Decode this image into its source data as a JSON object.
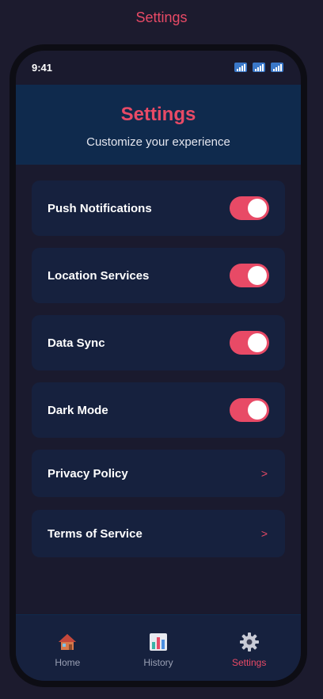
{
  "page": {
    "title": "Settings"
  },
  "status_bar": {
    "time": "9:41"
  },
  "header": {
    "title": "Settings",
    "subtitle": "Customize your experience"
  },
  "settings": {
    "toggles": [
      {
        "label": "Push Notifications",
        "enabled": true
      },
      {
        "label": "Location Services",
        "enabled": true
      },
      {
        "label": "Data Sync",
        "enabled": true
      },
      {
        "label": "Dark Mode",
        "enabled": true
      }
    ],
    "links": [
      {
        "label": "Privacy Policy",
        "chevron": ">"
      },
      {
        "label": "Terms of Service",
        "chevron": ">"
      }
    ]
  },
  "nav": {
    "items": [
      {
        "label": "Home",
        "icon": "home-icon"
      },
      {
        "label": "History",
        "icon": "history-icon"
      },
      {
        "label": "Settings",
        "icon": "gear-icon",
        "active": true
      }
    ]
  },
  "colors": {
    "accent": "#e84a66",
    "background": "#1a1a2e",
    "card": "#16213e",
    "header": "#0f2a4d"
  }
}
